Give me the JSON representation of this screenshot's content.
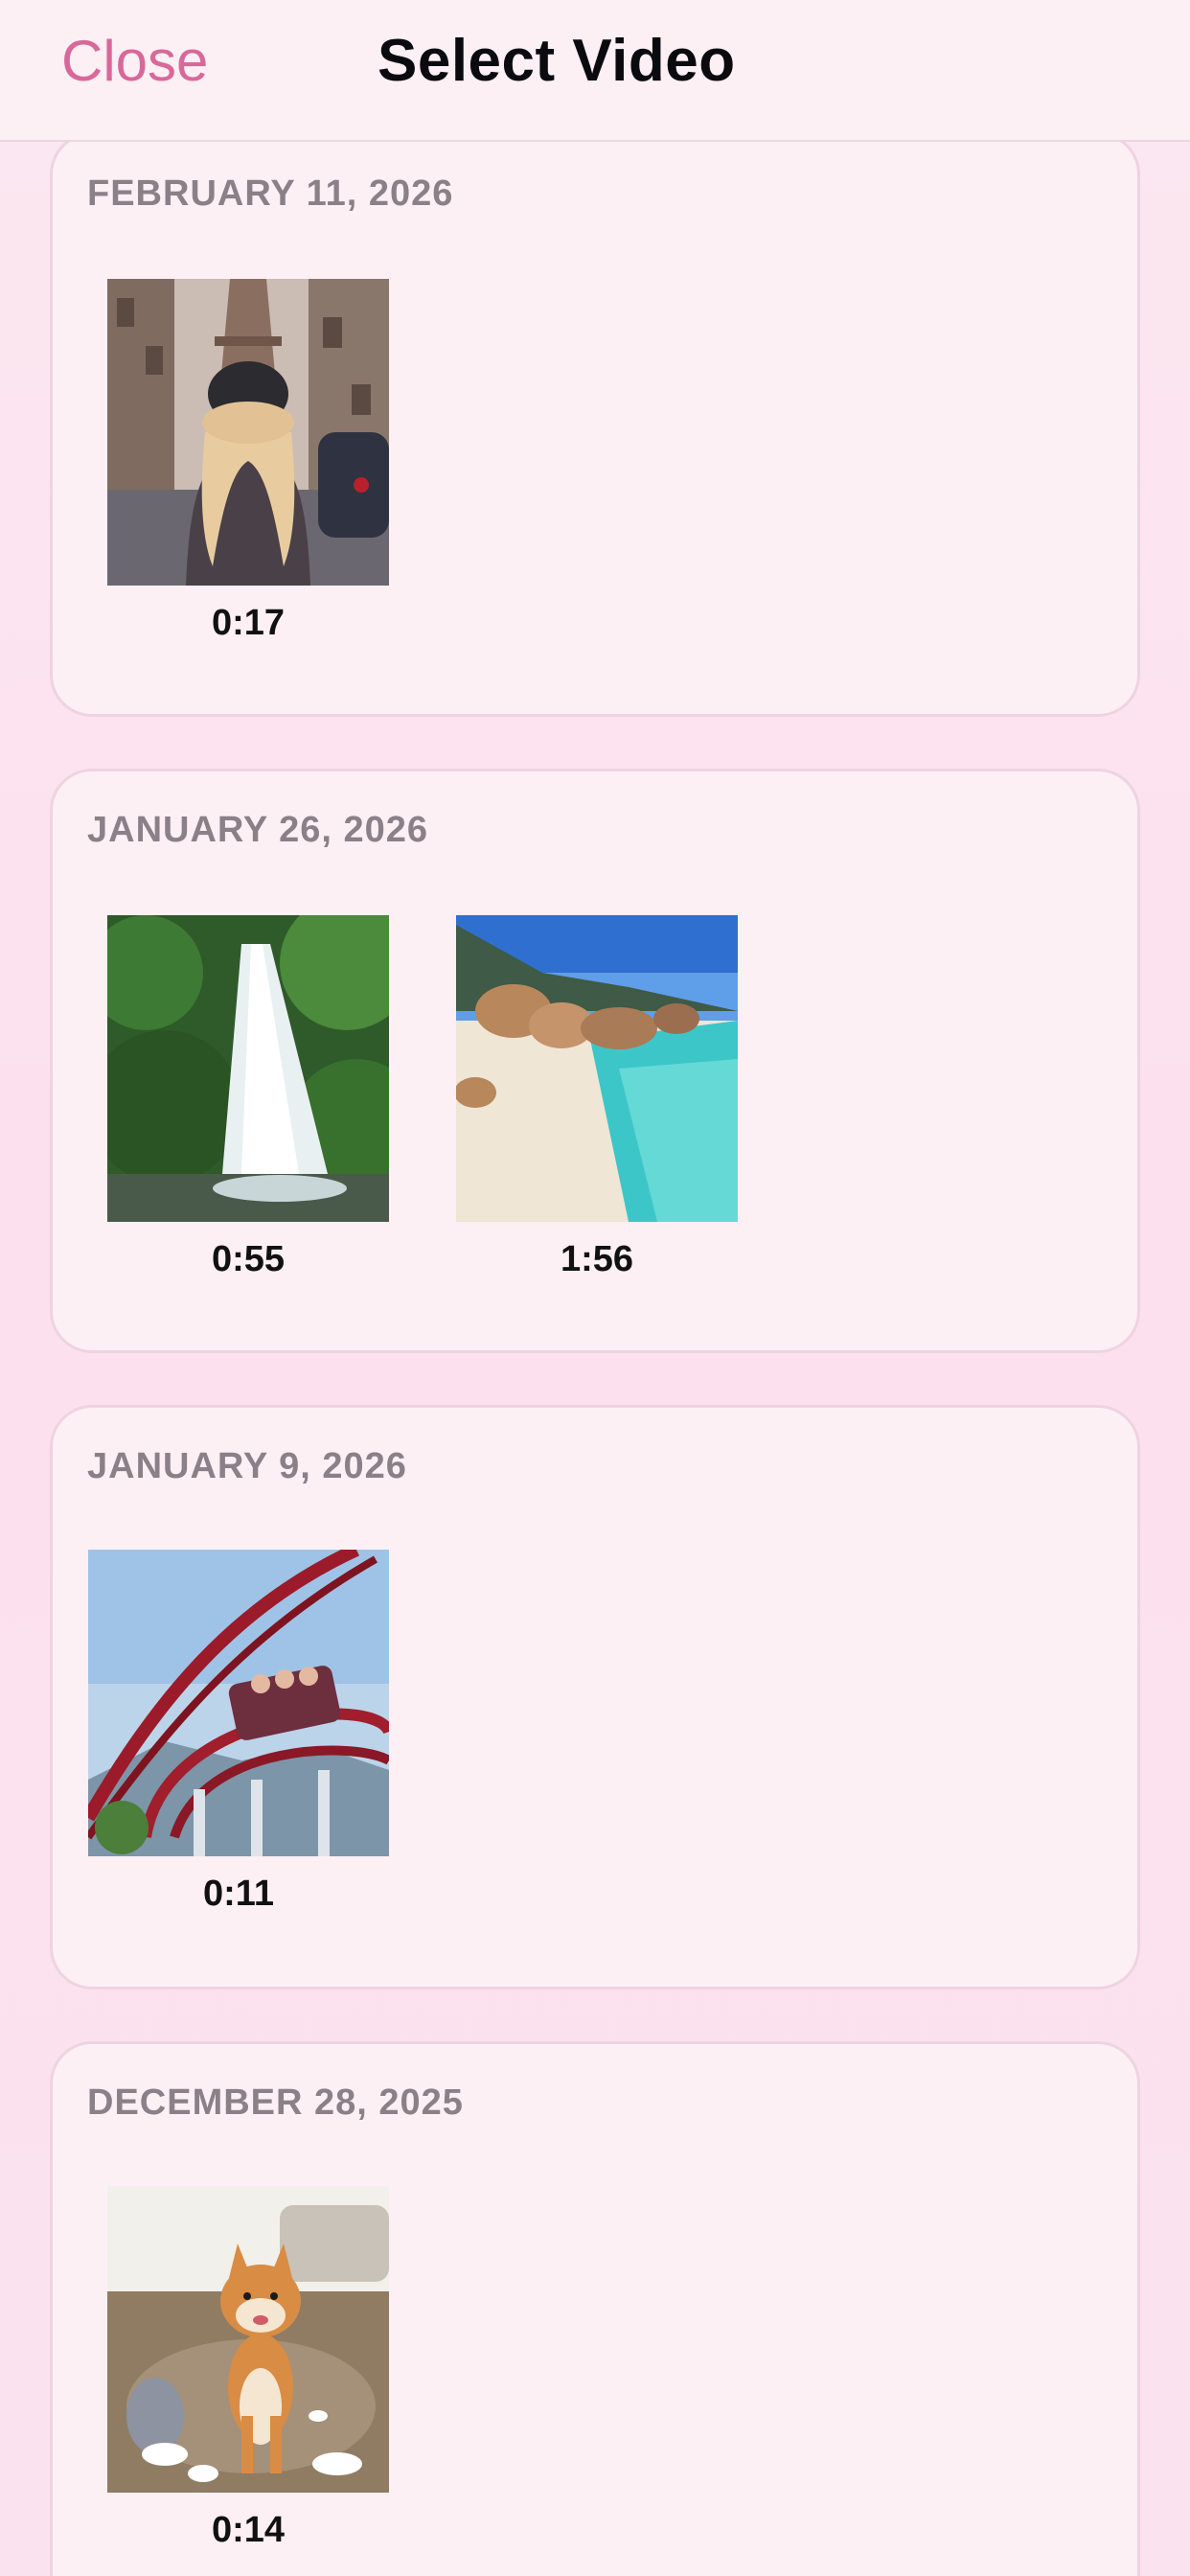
{
  "nav": {
    "close_label": "Close",
    "title": "Select Video"
  },
  "sections": [
    {
      "date": "FEBRUARY 11, 2026",
      "videos": [
        {
          "duration": "0:17",
          "thumbnail": "woman-eiffel-tower"
        }
      ]
    },
    {
      "date": "JANUARY 26, 2026",
      "videos": [
        {
          "duration": "0:55",
          "thumbnail": "waterfall"
        },
        {
          "duration": "1:56",
          "thumbnail": "tropical-beach"
        }
      ]
    },
    {
      "date": "JANUARY 9, 2026",
      "videos": [
        {
          "duration": "0:11",
          "thumbnail": "roller-coaster"
        }
      ]
    },
    {
      "date": "DECEMBER 28, 2025",
      "videos": [
        {
          "duration": "0:14",
          "thumbnail": "shiba-dog"
        }
      ]
    }
  ],
  "colors": {
    "accent": "#d9689a",
    "background": "#fbe4ef",
    "card": "#fcf0f5",
    "header_text": "#8b8088"
  }
}
